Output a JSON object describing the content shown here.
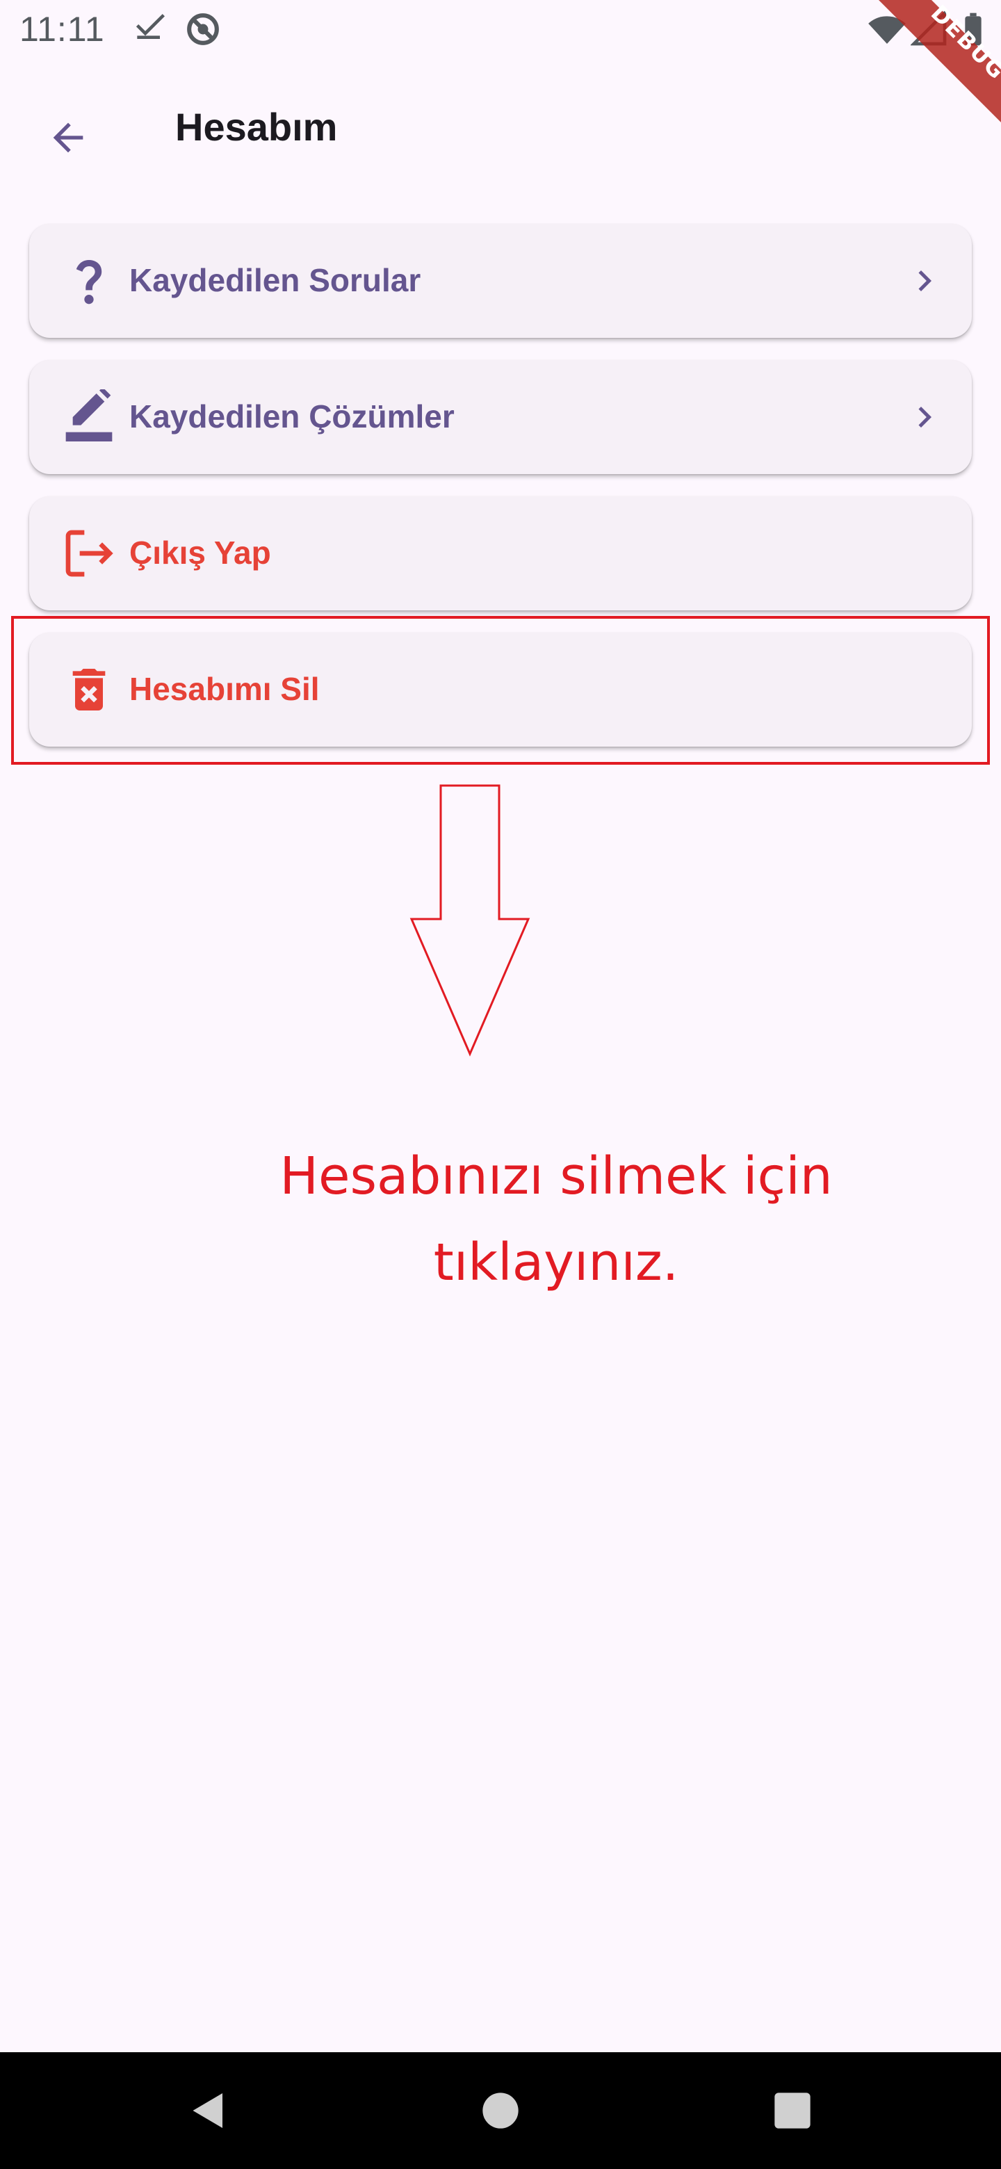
{
  "status_bar": {
    "time": "11:11",
    "icons": [
      "download-done-icon",
      "no-location-icon",
      "wifi-icon",
      "signal-icon",
      "battery-icon"
    ],
    "debug_banner": "DEBUG"
  },
  "app_bar": {
    "title": "Hesabım",
    "back_icon": "arrow-back-icon"
  },
  "menu": {
    "items": [
      {
        "label": "Kaydedilen Sorular",
        "icon": "question-mark-icon",
        "trailing": "chevron-right-icon",
        "color": "#64558f"
      },
      {
        "label": "Kaydedilen Çözümler",
        "icon": "edit-pen-icon",
        "trailing": "chevron-right-icon",
        "color": "#64558f"
      },
      {
        "label": "Çıkış Yap",
        "icon": "logout-icon",
        "color": "#e64237"
      },
      {
        "label": "Hesabımı Sil",
        "icon": "delete-forever-icon",
        "color": "#e64237"
      }
    ]
  },
  "annotation": {
    "hint_text": "Hesabınızı silmek için tıklayınız.",
    "color": "#e21b23"
  },
  "nav_bar": {
    "buttons": [
      "back-triangle-icon",
      "home-circle-icon",
      "recents-square-icon"
    ]
  },
  "colors": {
    "background": "#fdf7fe",
    "card": "#f6f0f7",
    "primary": "#64558f",
    "danger": "#e64237",
    "annotation": "#e21b23"
  }
}
